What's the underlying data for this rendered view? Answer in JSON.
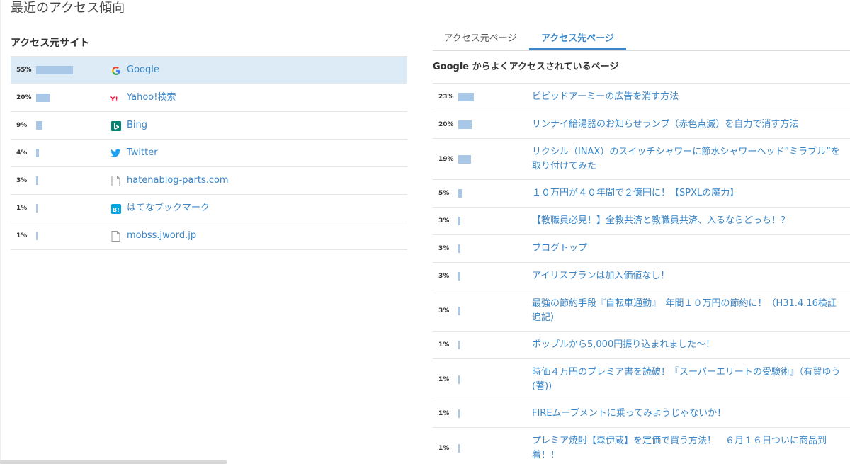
{
  "page_title": "最近のアクセス傾向",
  "left": {
    "heading": "アクセス元サイト",
    "sites": [
      {
        "pct": "55%",
        "value": 55,
        "name": "Google",
        "icon": "google-icon",
        "selected": true
      },
      {
        "pct": "20%",
        "value": 20,
        "name": "Yahoo!検索",
        "icon": "yahoo-icon"
      },
      {
        "pct": "9%",
        "value": 9,
        "name": "Bing",
        "icon": "bing-icon"
      },
      {
        "pct": "4%",
        "value": 4,
        "name": "Twitter",
        "icon": "twitter-icon"
      },
      {
        "pct": "3%",
        "value": 3,
        "name": "hatenablog-parts.com",
        "icon": "page-icon"
      },
      {
        "pct": "1%",
        "value": 1,
        "name": "はてなブックマーク",
        "icon": "hatena-bookmark-icon"
      },
      {
        "pct": "1%",
        "value": 1,
        "name": "mobss.jword.jp",
        "icon": "page-icon"
      }
    ]
  },
  "right": {
    "tabs": [
      {
        "label": "アクセス元ページ",
        "active": false
      },
      {
        "label": "アクセス先ページ",
        "active": true
      }
    ],
    "heading": "Google からよくアクセスされているページ",
    "pages": [
      {
        "pct": "23%",
        "value": 23,
        "title": "ビビッドアーミーの広告を消す方法",
        "lines": 1
      },
      {
        "pct": "20%",
        "value": 20,
        "title": "リンナイ給湯器のお知らせランプ（赤色点滅）を自力で消す方法",
        "lines": 1
      },
      {
        "pct": "19%",
        "value": 19,
        "title": "リクシル（INAX）のスイッチシャワーに節水シャワーヘッド”ミラブル”を取り付けてみた",
        "lines": 2
      },
      {
        "pct": "5%",
        "value": 5,
        "title": "１０万円が４０年間で２億円に！【SPXLの魔力】",
        "lines": 1
      },
      {
        "pct": "3%",
        "value": 3,
        "title": "【教職員必見！】全教共済と教職員共済、入るならどっち！？",
        "lines": 1
      },
      {
        "pct": "3%",
        "value": 3,
        "title": "ブログトップ",
        "lines": 1
      },
      {
        "pct": "3%",
        "value": 3,
        "title": "アイリスプランは加入価値なし！",
        "lines": 1
      },
      {
        "pct": "3%",
        "value": 3,
        "title": "最強の節約手段『自転車通勤』　年間１０万円の節約に！（H31.4.16検証追記）",
        "lines": 2
      },
      {
        "pct": "1%",
        "value": 1,
        "title": "ポップルから5,000円振り込まれました～！",
        "lines": 1
      },
      {
        "pct": "1%",
        "value": 1,
        "title": "時価４万円のプレミア書を読破！『スーパーエリートの受験術』（有賀ゆう (著))",
        "lines": 2
      },
      {
        "pct": "1%",
        "value": 1,
        "title": "FIREムーブメントに乗ってみようじゃないか！",
        "lines": 1
      },
      {
        "pct": "1%",
        "value": 1,
        "title": "プレミア焼酎【森伊蔵】を定価で買う方法！　６月１６日ついに商品到着！！",
        "lines": 2
      }
    ]
  },
  "colors": {
    "link": "#3a86c8",
    "bar": "#a9c8e8",
    "selected_bg": "#dcebf6"
  }
}
